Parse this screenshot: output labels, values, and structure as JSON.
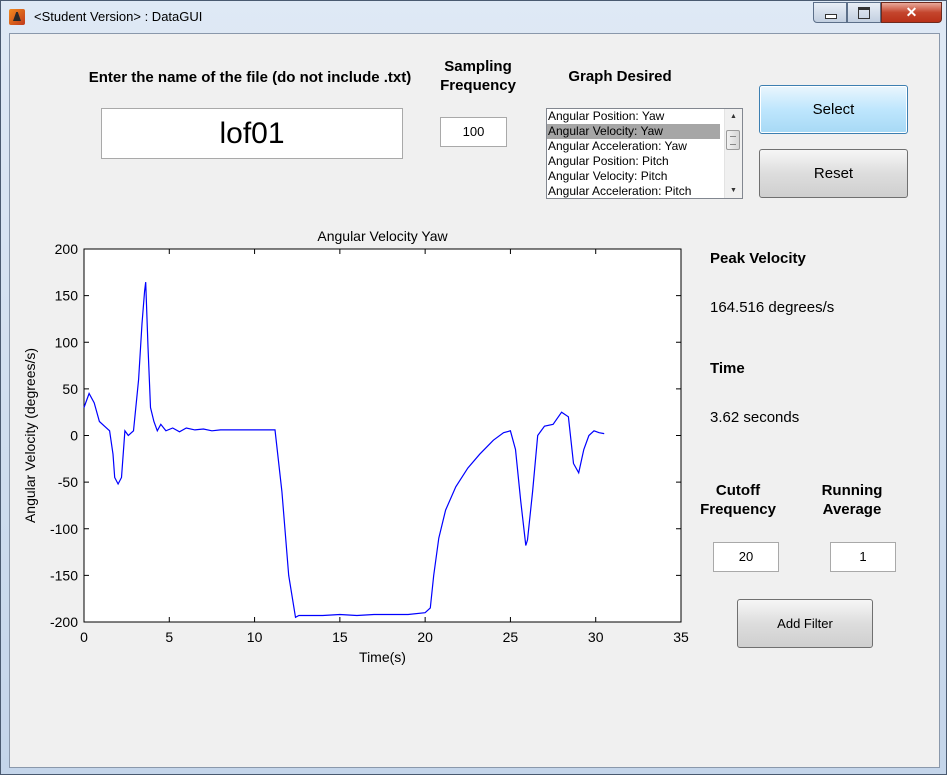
{
  "window": {
    "title": "<Student Version> : DataGUI",
    "close_glyph": "✕"
  },
  "file_input": {
    "label": "Enter the name of the file (do not include .txt)",
    "value": "lof01"
  },
  "sampling": {
    "label_line1": "Sampling",
    "label_line2": "Frequency",
    "value": "100"
  },
  "graph_select": {
    "label": "Graph Desired",
    "options": [
      "Angular Position: Yaw",
      "Angular Velocity: Yaw",
      "Angular Acceleration: Yaw",
      "Angular Position: Pitch",
      "Angular Velocity: Pitch",
      "Angular Acceleration: Pitch"
    ],
    "selected_index": 1
  },
  "buttons": {
    "select": "Select",
    "reset": "Reset",
    "add_filter": "Add Filter"
  },
  "results": {
    "peak_label": "Peak Velocity",
    "peak_value": "164.516 degrees/s",
    "time_label": "Time",
    "time_value": "3.62 seconds"
  },
  "filter": {
    "cutoff_line1": "Cutoff",
    "cutoff_line2": "Frequency",
    "cutoff_value": "20",
    "running_line1": "Running",
    "running_line2": "Average",
    "running_value": "1"
  },
  "chart_data": {
    "type": "line",
    "title": "Angular Velocity Yaw",
    "xlabel": "Time(s)",
    "ylabel": "Angular Velocity (degrees/s)",
    "xlim": [
      0,
      35
    ],
    "ylim": [
      -200,
      200
    ],
    "xticks": [
      0,
      5,
      10,
      15,
      20,
      25,
      30,
      35
    ],
    "yticks": [
      200,
      150,
      100,
      50,
      0,
      -50,
      -100,
      -150,
      -200
    ],
    "grid": false,
    "color": "#0000ff",
    "series": [
      {
        "x": [
          0,
          0.3,
          0.6,
          0.9,
          1.2,
          1.5,
          1.7,
          1.8,
          2.0,
          2.2,
          2.4,
          2.6,
          2.9,
          3.2,
          3.4,
          3.55,
          3.62,
          3.75,
          3.9,
          4.1,
          4.3,
          4.5,
          4.8,
          5.2,
          5.6,
          6.0,
          6.5,
          7.0,
          7.5,
          8.0,
          9.0,
          10.0,
          11.0,
          11.2,
          11.6,
          12.0,
          12.4,
          12.6,
          13.0,
          14.0,
          15.0,
          16.0,
          17.0,
          18.0,
          19.0,
          20.0,
          20.3,
          20.5,
          20.8,
          21.2,
          21.8,
          22.5,
          23.2,
          24.0,
          24.6,
          25.0,
          25.3,
          25.6,
          25.9,
          26.0,
          26.3,
          26.6,
          27.0,
          27.5,
          28.0,
          28.4,
          28.7,
          29.0,
          29.3,
          29.6,
          29.9,
          30.2,
          30.5
        ],
        "y": [
          30,
          45,
          35,
          15,
          10,
          5,
          -20,
          -45,
          -52,
          -45,
          5,
          0,
          5,
          60,
          120,
          155,
          164.5,
          95,
          30,
          15,
          5,
          12,
          5,
          8,
          4,
          8,
          6,
          7,
          5,
          6,
          6,
          6,
          6,
          6,
          -60,
          -150,
          -195,
          -193,
          -193,
          -193,
          -192,
          -193,
          -192,
          -192,
          -192,
          -190,
          -185,
          -150,
          -110,
          -80,
          -55,
          -35,
          -20,
          -5,
          3,
          5,
          -15,
          -70,
          -118,
          -112,
          -60,
          0,
          10,
          12,
          25,
          20,
          -30,
          -40,
          -15,
          0,
          5,
          3,
          2
        ]
      }
    ]
  }
}
